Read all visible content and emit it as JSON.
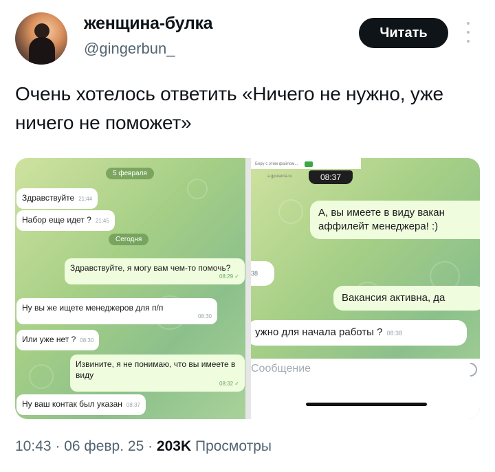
{
  "author": {
    "name": "женщина-булка",
    "handle": "@gingerbun_",
    "avatar_icon": "avatar-photo"
  },
  "actions": {
    "follow_label": "Читать",
    "more_icon": "more-vertical-icon"
  },
  "tweet": {
    "text": "Очень хотелось ответить «Ничего не нужно, уже ничего не поможет»"
  },
  "screenshot_left": {
    "date_pill_1": "5 февраля",
    "date_pill_2": "Сегодня",
    "messages": [
      {
        "dir": "in",
        "text": "Здравствуйте",
        "time": "21:44"
      },
      {
        "dir": "in",
        "text": "Набор еще идет ?",
        "time": "21:45"
      },
      {
        "dir": "out",
        "text": "Здравствуйте, я могу вам чем-то помочь?",
        "time": "08:29"
      },
      {
        "dir": "in",
        "text": "Ну вы же ищете менеджеров для п/п",
        "time": "08:30"
      },
      {
        "dir": "in",
        "text": "Или уже нет ?",
        "time": "08:30"
      },
      {
        "dir": "out",
        "text": "Извините, я не понимаю, что вы имеете в виду",
        "time": "08:32"
      },
      {
        "dir": "in",
        "text": "Ну ваш контак был указан",
        "time": "08:37"
      }
    ]
  },
  "screenshot_right": {
    "status_text": "Беру с этим файлом...",
    "url_text": "a.gpuserra.ru",
    "clock": "08:37",
    "messages": [
      {
        "dir": "out",
        "text": "А, вы имеете в виду вакан аффилейт менеджера! :)"
      },
      {
        "dir": "in",
        "text": "38"
      },
      {
        "dir": "out",
        "text": "Вакансия активна, да"
      },
      {
        "dir": "in",
        "text": "ужно для начала работы ?",
        "time": "08:38"
      }
    ],
    "input_placeholder": "Сообщение"
  },
  "meta": {
    "time": "10:43",
    "date": "06 февр. 25",
    "views_count": "203K",
    "views_label": "Просмотры"
  }
}
